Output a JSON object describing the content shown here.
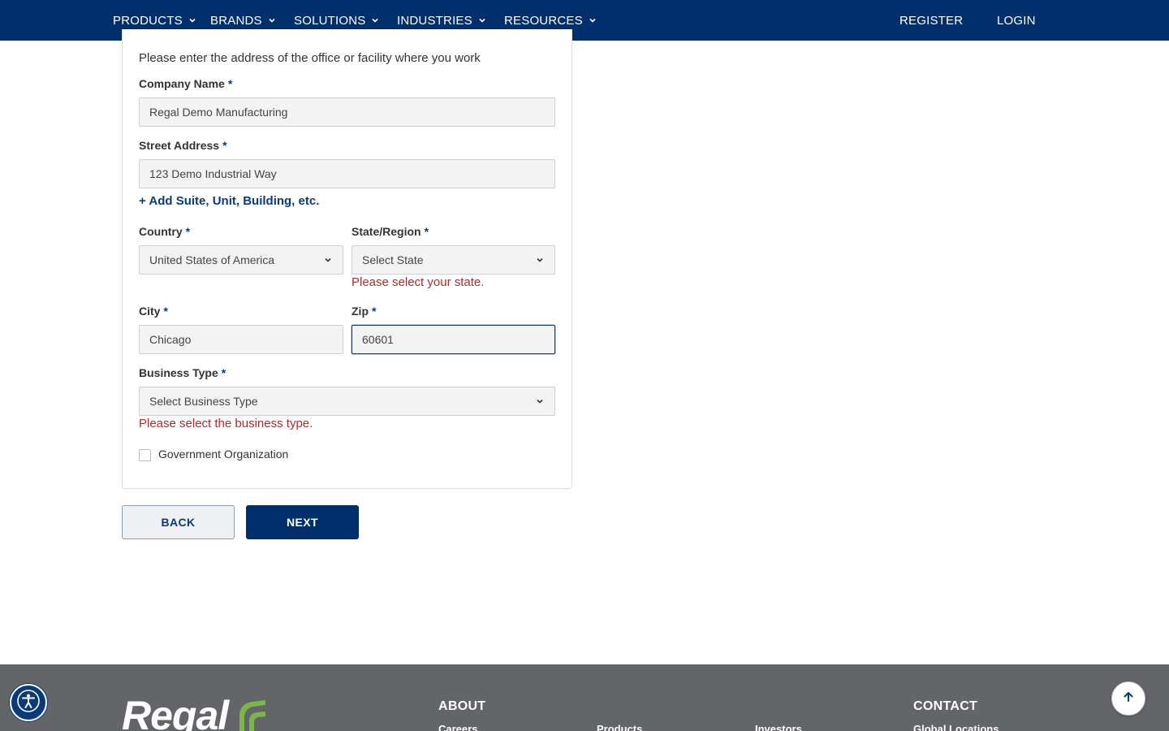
{
  "nav": {
    "items": [
      {
        "label": "PRODUCTS"
      },
      {
        "label": "BRANDS"
      },
      {
        "label": "SOLUTIONS"
      },
      {
        "label": "INDUSTRIES"
      },
      {
        "label": "RESOURCES"
      }
    ],
    "register": "REGISTER",
    "login": "LOGIN"
  },
  "form": {
    "intro": "Please enter the address of the office or facility where you work",
    "required_marker": "*",
    "company_name": {
      "label": "Company Name",
      "value": "Regal Demo Manufacturing"
    },
    "street_address": {
      "label": "Street Address",
      "value": "123 Demo Industrial Way"
    },
    "add_suite_link": "+ Add Suite, Unit, Building, etc.",
    "country": {
      "label": "Country",
      "value": "United States of America"
    },
    "state": {
      "label": "State/Region",
      "value": "Select State",
      "error": "Please select your state."
    },
    "city": {
      "label": "City",
      "value": "Chicago"
    },
    "zip": {
      "label": "Zip",
      "value": "60601"
    },
    "business_type": {
      "label": "Business Type",
      "value": "Select Business Type",
      "error": "Please select the business type."
    },
    "government_org": {
      "label": "Government Organization",
      "checked": false
    }
  },
  "buttons": {
    "back": "BACK",
    "next": "NEXT"
  },
  "footer": {
    "logo_text": "Regal",
    "about_heading": "ABOUT",
    "contact_heading": "CONTACT",
    "links": [
      "Careers",
      "Products",
      "Investors",
      "Global Locations"
    ]
  },
  "colors": {
    "brand_navy": "#002f6c",
    "error_red": "#b02a2a",
    "footer_gray": "#646569",
    "logo_green": "#7ab648"
  },
  "icons": {
    "a11y": "accessibility-icon",
    "to_top": "arrow-up-icon",
    "dropdown": "chevron-down-icon"
  }
}
